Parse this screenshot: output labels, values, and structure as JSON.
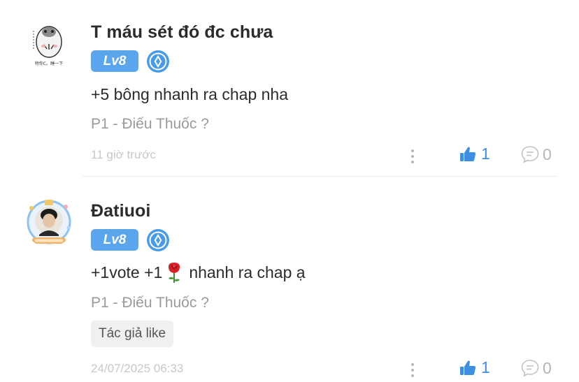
{
  "comments": [
    {
      "username": "T máu sét đó đc chưa",
      "level": "Lv8",
      "content": "+5 bông nhanh ra chap nha",
      "chapter": "P1 - Điếu Thuốc ?",
      "timestamp": "11 giờ trước",
      "likes": "1",
      "replies": "0",
      "avatar_icon": "meme-face-avatar",
      "avatar_caption": "特你C。睡一下"
    },
    {
      "username": "Đatiuoi",
      "level": "Lv8",
      "content_before": "+1vote +1",
      "content_after": "nhanh ra chap ạ",
      "content_icon": "rose-icon",
      "chapter": "P1 - Điếu Thuốc ?",
      "tag": "Tác giả like",
      "timestamp": "24/07/2025 06:33",
      "likes": "1",
      "replies": "0",
      "avatar_icon": "user-photo-avatar"
    }
  ],
  "colors": {
    "level_badge": "#5aa5ec",
    "like_accent": "#3e8fe0",
    "muted_text": "#9a9a9a",
    "timestamp_text": "#c8c8c8"
  }
}
